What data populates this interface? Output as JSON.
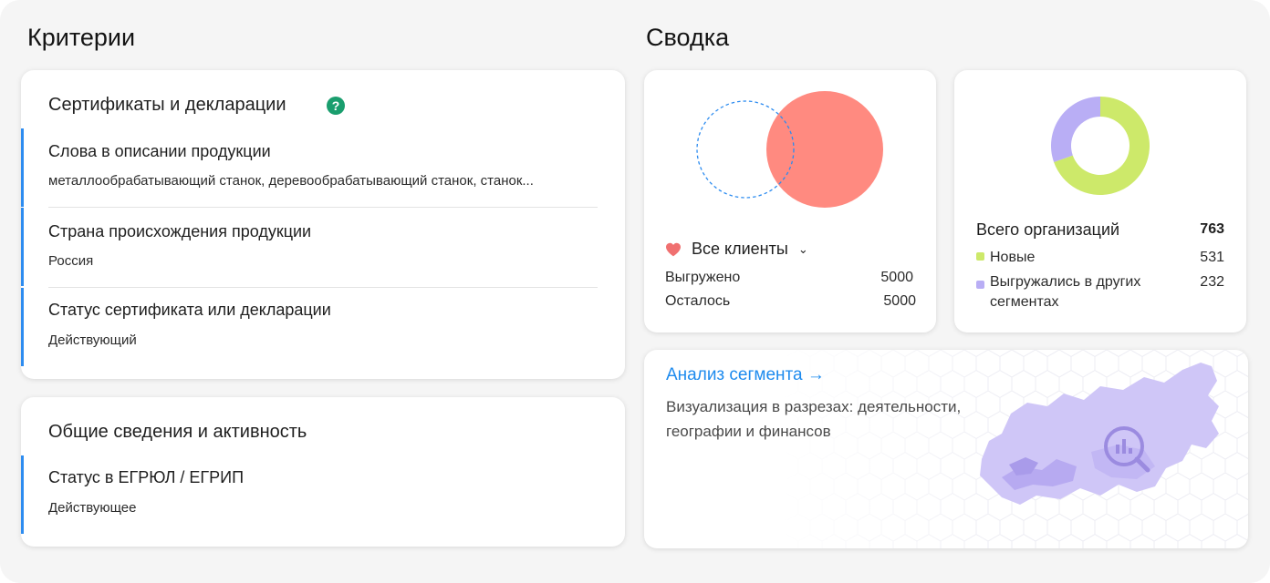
{
  "criteria": {
    "title": "Критерии",
    "card1": {
      "heading": "Сертификаты и декларации",
      "help_icon": "question-circle-icon",
      "items": [
        {
          "label": "Слова в описании продукции",
          "value": "металлообрабатывающий станок, деревообрабатывающий станок, станок..."
        },
        {
          "label": "Страна происхождения продукции",
          "value": "Россия"
        },
        {
          "label": "Статус сертификата или декларации",
          "value": "Действующий"
        }
      ]
    },
    "card2": {
      "heading": "Общие сведения и активность",
      "items": [
        {
          "label": "Статус в ЕГРЮЛ / ЕГРИП",
          "value": "Действующее"
        }
      ]
    }
  },
  "summary": {
    "title": "Сводка",
    "clients": {
      "dropdown_label": "Все клиенты",
      "rows": [
        {
          "label": "Выгружено",
          "value": "5000"
        },
        {
          "label": "Осталось",
          "value": "5000"
        }
      ],
      "colors": {
        "filled": "#ff8a80",
        "dashed": "#2d8cf0",
        "heart": "#f07070"
      }
    },
    "organizations": {
      "total_label": "Всего организаций",
      "total_value": "763",
      "legend": [
        {
          "label": "Новые",
          "value": "531",
          "color": "#cde96a"
        },
        {
          "label": "Выгружались в других сегментах",
          "value": "232",
          "color": "#b9aef5"
        }
      ]
    },
    "analysis": {
      "link_label": "Анализ сегмента →",
      "description": "Визуализация в разрезах: деятельности, географии и финансов",
      "map_icon": "magnifier-chart-icon"
    }
  },
  "colors": {
    "accent_blue": "#1e8bee",
    "criteria_bar": "#2d8cf0",
    "help_green": "#1a9e6e",
    "map_purple": "#b8aef3"
  }
}
